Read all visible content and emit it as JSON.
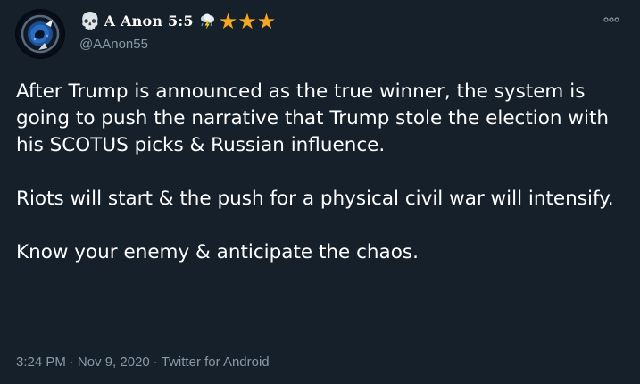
{
  "author": {
    "display_name": "A Anon 5:5",
    "handle": "@AAnon55",
    "emoji_prefix": "skull-icon",
    "emoji_suffix": [
      "storm-cloud-icon",
      "star-icon",
      "star-icon",
      "star-icon"
    ],
    "star_glyph": "★",
    "skull_glyph": "💀"
  },
  "tweet": {
    "paragraphs": [
      "After Trump is announced as the true winner, the system is going to push the narrative that Trump stole the election with his SCOTUS picks & Russian influence.",
      "Riots will start & the push for a physical civil war will intensify.",
      "Know your enemy & anticipate the chaos."
    ],
    "time": "3:24 PM",
    "date": "Nov 9, 2020",
    "separator": "·",
    "source": "Twitter for Android"
  },
  "colors": {
    "background": "#15202b",
    "text_primary": "#ffffff",
    "text_secondary": "#8899a6",
    "star": "#f5a623"
  },
  "more_menu": {
    "icon": "more-icon"
  }
}
